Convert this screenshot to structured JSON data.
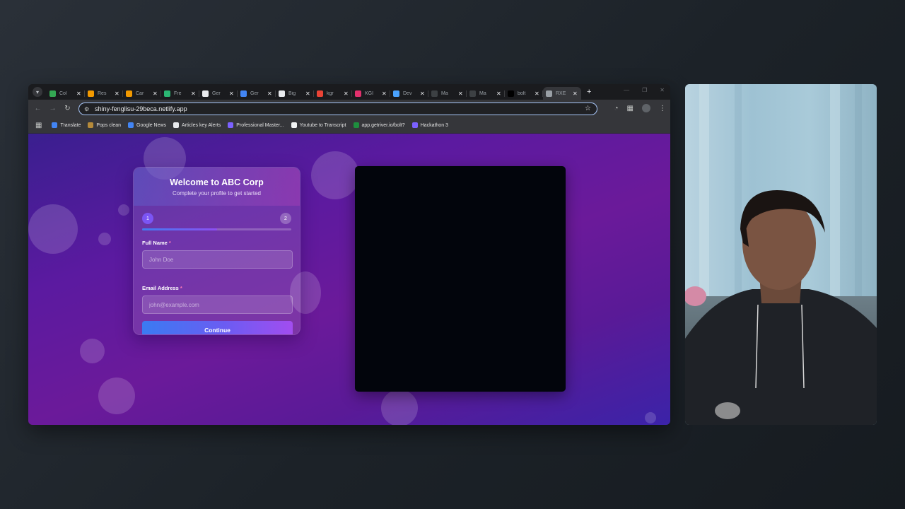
{
  "browser": {
    "tab_menu_icon": "chevron-down-icon",
    "tabs": [
      {
        "title": "Col",
        "favicon_color": "#34a853",
        "favicon_icon": "drive-icon",
        "active": false
      },
      {
        "title": "Res",
        "favicon_color": "#f29900",
        "favicon_icon": "infinity-icon",
        "active": false
      },
      {
        "title": "Car",
        "favicon_color": "#f29900",
        "favicon_icon": "infinity-icon",
        "active": false
      },
      {
        "title": "Fre",
        "favicon_color": "#2bb673",
        "favicon_icon": "shield-icon",
        "active": false
      },
      {
        "title": "Ger",
        "favicon_color": "#e8eaed",
        "favicon_icon": "doc-icon",
        "active": false
      },
      {
        "title": "Ger",
        "favicon_color": "#4285f4",
        "favicon_icon": "cloud-icon",
        "active": false
      },
      {
        "title": "Big",
        "favicon_color": "#e8eaed",
        "favicon_icon": "globe-icon",
        "active": false
      },
      {
        "title": "kgr",
        "favicon_color": "#ea4335",
        "favicon_icon": "gmail-icon",
        "active": false
      },
      {
        "title": "KGI",
        "favicon_color": "#e1306c",
        "favicon_icon": "instagram-icon",
        "active": false
      },
      {
        "title": "Dev",
        "favicon_color": "#4aa3ff",
        "favicon_icon": "dev-icon",
        "active": false
      },
      {
        "title": "Ma",
        "favicon_color": "#3c4043",
        "favicon_icon": "mail-icon",
        "active": false
      },
      {
        "title": "Ma",
        "favicon_color": "#3c4043",
        "favicon_icon": "mail-icon",
        "active": false
      },
      {
        "title": "bolt",
        "favicon_color": "#000000",
        "favicon_icon": "bolt-icon",
        "active": false
      },
      {
        "title": "RXE",
        "favicon_color": "#9aa0a6",
        "favicon_icon": "globe-icon",
        "active": true
      }
    ],
    "new_tab_label": "+",
    "url": "shiny-fenglisu-29beca.netlify.app",
    "bookmarks": [
      {
        "label": "Translate",
        "favicon_color": "#4285f4"
      },
      {
        "label": "Pops clean",
        "favicon_color": "#b58a3a"
      },
      {
        "label": "Google News",
        "favicon_color": "#4285f4"
      },
      {
        "label": "Articles key  Alerts",
        "favicon_color": "#e8eaed"
      },
      {
        "label": "Professional Master...",
        "favicon_color": "#7b61ff"
      },
      {
        "label": "Youtube to Transcript",
        "favicon_color": "#f1f3f4"
      },
      {
        "label": "app.getriver.io/bolt?",
        "favicon_color": "#1e8e3e"
      },
      {
        "label": "Hackathon 3",
        "favicon_color": "#7b61ff"
      }
    ]
  },
  "onboarding": {
    "title": "Welcome to ABC Corp",
    "subtitle": "Complete your profile to get started",
    "steps": [
      "1",
      "2"
    ],
    "current_step": 1,
    "progress_fraction": 0.5,
    "full_name_label": "Full Name",
    "full_name_placeholder": "John Doe",
    "email_label": "Email Address",
    "email_placeholder": "john@example.com",
    "required_marker": "*",
    "continue_label": "Continue"
  },
  "colors": {
    "accent_blue": "#3a7bf2",
    "accent_purple": "#a24df0",
    "page_background": "#5b1aa0"
  }
}
